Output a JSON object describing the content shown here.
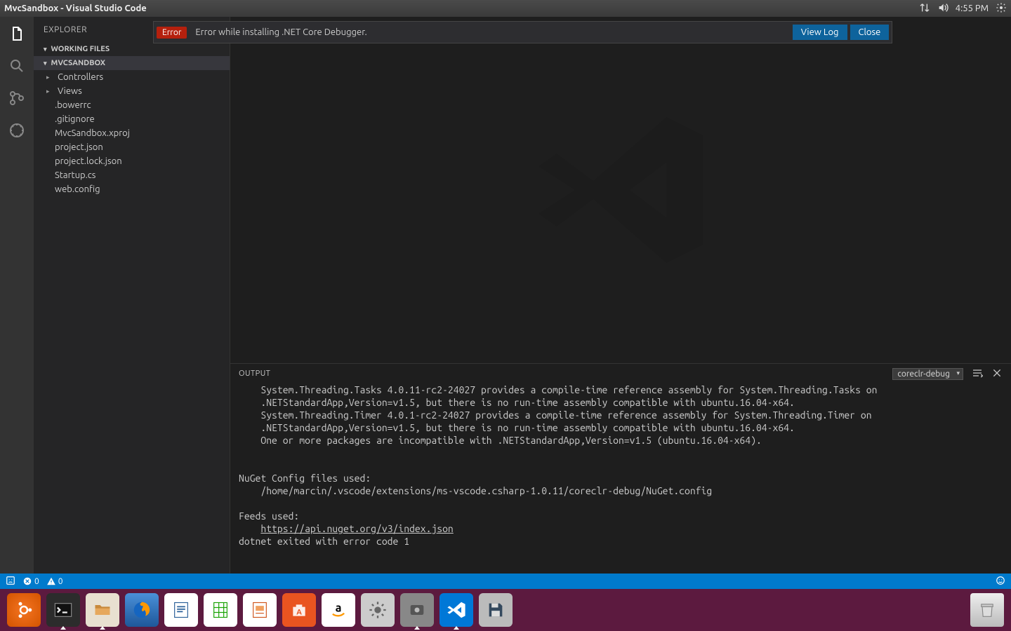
{
  "topbar": {
    "title": "MvcSandbox - Visual Studio Code",
    "time": "4:55 PM"
  },
  "sidebar": {
    "title": "EXPLORER",
    "working_files": "WORKING FILES",
    "project": "MVCSANDBOX",
    "items": [
      {
        "label": "Controllers",
        "folder": true
      },
      {
        "label": "Views",
        "folder": true
      },
      {
        "label": ".bowerrc",
        "folder": false
      },
      {
        "label": ".gitignore",
        "folder": false
      },
      {
        "label": "MvcSandbox.xproj",
        "folder": false
      },
      {
        "label": "project.json",
        "folder": false
      },
      {
        "label": "project.lock.json",
        "folder": false
      },
      {
        "label": "Startup.cs",
        "folder": false
      },
      {
        "label": "web.config",
        "folder": false
      }
    ]
  },
  "notification": {
    "badge": "Error",
    "message": "Error while installing .NET Core Debugger.",
    "view_log": "View Log",
    "close": "Close"
  },
  "panel": {
    "title": "OUTPUT",
    "select": "coreclr-debug",
    "lines": "    System.Threading.Tasks 4.0.11-rc2-24027 provides a compile-time reference assembly for System.Threading.Tasks on\n    .NETStandardApp,Version=v1.5, but there is no run-time assembly compatible with ubuntu.16.04-x64.\n    System.Threading.Timer 4.0.1-rc2-24027 provides a compile-time reference assembly for System.Threading.Timer on\n    .NETStandardApp,Version=v1.5, but there is no run-time assembly compatible with ubuntu.16.04-x64.\n    One or more packages are incompatible with .NETStandardApp,Version=v1.5 (ubuntu.16.04-x64).\n\n\nNuGet Config files used:\n    /home/marcin/.vscode/extensions/ms-vscode.csharp-1.0.11/coreclr-debug/NuGet.config\n\nFeeds used:",
    "feed_link": "https://api.nuget.org/v3/index.json",
    "exit_line": "dotnet exited with error code 1"
  },
  "statusbar": {
    "errors": "0",
    "warnings": "0"
  }
}
